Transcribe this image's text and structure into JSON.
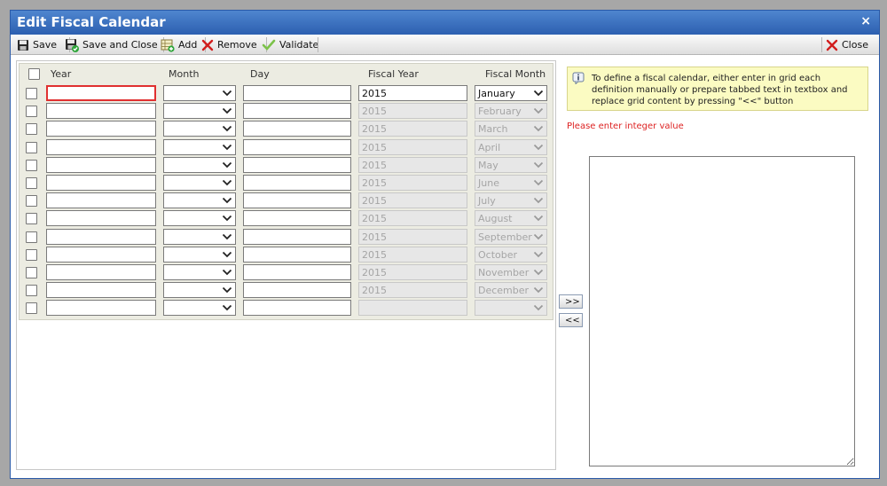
{
  "window": {
    "title": "Edit Fiscal Calendar",
    "close_glyph": "×"
  },
  "toolbar": {
    "save": {
      "label": "Save",
      "icon": "floppy-disk-icon"
    },
    "save_close": {
      "label": "Save and Close",
      "icon": "floppy-disk-check-icon"
    },
    "add": {
      "label": "Add",
      "icon": "add-row-icon"
    },
    "remove": {
      "label": "Remove",
      "icon": "red-x-icon"
    },
    "validate": {
      "label": "Validate",
      "icon": "green-check-icon"
    },
    "close": {
      "label": "Close",
      "icon": "red-x-icon"
    }
  },
  "grid": {
    "headers": {
      "year": "Year",
      "month": "Month",
      "day": "Day",
      "fiscal_year": "Fiscal Year",
      "fiscal_month": "Fiscal Month"
    },
    "rows": [
      {
        "fiscal_year": "2015",
        "fiscal_month": "January",
        "enabled": true
      },
      {
        "fiscal_year": "2015",
        "fiscal_month": "February",
        "enabled": false
      },
      {
        "fiscal_year": "2015",
        "fiscal_month": "March",
        "enabled": false
      },
      {
        "fiscal_year": "2015",
        "fiscal_month": "April",
        "enabled": false
      },
      {
        "fiscal_year": "2015",
        "fiscal_month": "May",
        "enabled": false
      },
      {
        "fiscal_year": "2015",
        "fiscal_month": "June",
        "enabled": false
      },
      {
        "fiscal_year": "2015",
        "fiscal_month": "July",
        "enabled": false
      },
      {
        "fiscal_year": "2015",
        "fiscal_month": "August",
        "enabled": false
      },
      {
        "fiscal_year": "2015",
        "fiscal_month": "September",
        "enabled": false
      },
      {
        "fiscal_year": "2015",
        "fiscal_month": "October",
        "enabled": false
      },
      {
        "fiscal_year": "2015",
        "fiscal_month": "November",
        "enabled": false
      },
      {
        "fiscal_year": "2015",
        "fiscal_month": "December",
        "enabled": false
      },
      {
        "fiscal_year": "",
        "fiscal_month": "",
        "enabled": false
      }
    ]
  },
  "transfer": {
    "to_text": ">>",
    "to_grid": "<<"
  },
  "info": {
    "icon": "info-icon",
    "text": "To define a fiscal calendar, either enter in grid each definition manually or prepare tabbed text in textbox and replace grid content by pressing \"<<\" button"
  },
  "error": {
    "text": "Please enter integer value"
  },
  "colors": {
    "title_bar": "#2c5fb0",
    "error": "#dd2222",
    "info_bg": "#fbfbc2",
    "invalid_border": "#e03030"
  }
}
